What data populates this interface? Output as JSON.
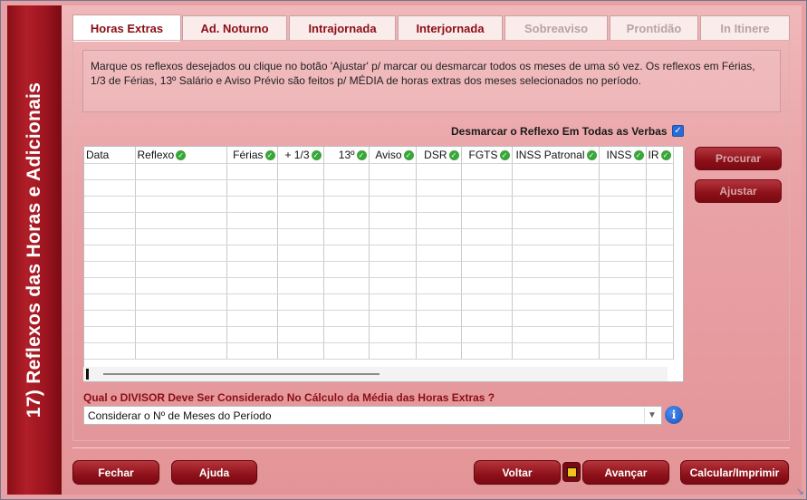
{
  "sidebar": {
    "title": "17) Reflexos das Horas e Adicionais"
  },
  "tabs": [
    {
      "label": "Horas Extras",
      "state": "active"
    },
    {
      "label": "Ad. Noturno",
      "state": "enabled"
    },
    {
      "label": "Intrajornada",
      "state": "enabled"
    },
    {
      "label": "Interjornada",
      "state": "enabled"
    },
    {
      "label": "Sobreaviso",
      "state": "disabled"
    },
    {
      "label": "Prontidão",
      "state": "disabled"
    },
    {
      "label": "In Itinere",
      "state": "disabled"
    }
  ],
  "info": {
    "text": "Marque os reflexos desejados ou clique no botão 'Ajustar' p/ marcar ou desmarcar todos os meses de uma só vez. Os reflexos em Férias,  1/3 de Férias, 13º Salário e Aviso Prévio são feitos p/ MÉDIA de horas extras dos meses selecionados no período."
  },
  "desmarcar": {
    "label": "Desmarcar o Reflexo Em Todas as Verbas",
    "checked": true
  },
  "grid": {
    "columns": [
      "Data",
      "Reflexo",
      "Férias",
      "+ 1/3",
      "13º",
      "Aviso",
      "DSR",
      "FGTS",
      "INSS Patronal",
      "INSS",
      "IR"
    ],
    "rows": 12
  },
  "side_buttons": {
    "procurar": "Procurar",
    "ajustar": "Ajustar"
  },
  "divisor": {
    "label": "Qual o DIVISOR Deve Ser Considerado No Cálculo da Média das Horas Extras ?",
    "selected": "Considerar o Nº de Meses do Período"
  },
  "footer": {
    "fechar": "Fechar",
    "ajuda": "Ajuda",
    "voltar": "Voltar",
    "avancar": "Avançar",
    "calcular": "Calcular/Imprimir"
  },
  "colors": {
    "brand": "#8a0e16",
    "panel": "#e9a2a6",
    "checkbox": "#2a6bd6",
    "ok": "#3aa63a"
  }
}
